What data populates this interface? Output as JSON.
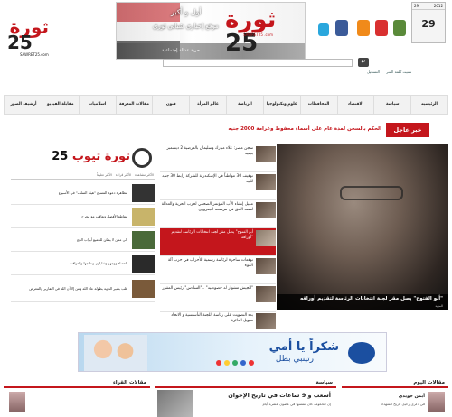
{
  "header": {
    "calendar": {
      "date_left": "29",
      "date_right": "2012",
      "day": "29"
    },
    "banner": {
      "logo_ar": "ثورة",
      "logo_num": "25",
      "site": "SAWRET25 .com",
      "slogan1": "أول و أكبر",
      "slogan2": "موقع إخباري شبابي ثوري",
      "slogan3": "حرية عدالة إجتماعية"
    },
    "logo": {
      "ar": "ثورة",
      "num": "25",
      "en": "SAWRET25.com"
    },
    "login": {
      "register": "التسجيل",
      "forgot": "نسيت كلمة السر"
    },
    "social_icons": [
      "calendar-icon",
      "youtube-icon",
      "rss-icon",
      "facebook-icon",
      "twitter-icon"
    ]
  },
  "nav": {
    "items": [
      "الرئيسيه",
      "سياسة",
      "الاقتصاد",
      "المحافظات",
      "علوم وتكنولوجيا",
      "الرياضة",
      "عالم المرأة",
      "فنون",
      "مقالات المعرفة",
      "اسلاميات",
      "مقابلة الفيديو",
      "أرشيف الصور"
    ]
  },
  "breaking": {
    "label": "خبر عاجل",
    "text": "الحكم بالسجن لمدة عام على أسماء محفوظ وغرامة 2000 جنيه"
  },
  "main_story": {
    "caption": "أبو الفتوح\" يصل مقر لجنة انتخابات الرئاسة لتقديم أوراقه\"",
    "sub": "المزيد"
  },
  "news": [
    {
      "text": "سجن مصر: علاء مبارك وسليمان بالعرضية 2 ديسمبر بجنيه"
    },
    {
      "text": "توقيف 30 مواطناً في الإسكندرية للشركة رابط 30 جنيه للبيه"
    },
    {
      "text": "مقيل إنشاء الأب المؤتمر الصحفي لحزب الحرية والعدالة لمنعه الحق في مرشحه الجنزوري"
    },
    {
      "text": "أبو الفتوح\" يصل مقر لجنة انتخابات الرئاسة لتقديم أوراقه\""
    },
    {
      "text": "توقعات ساحرة لرئاسة رسمية للأحزاب في حزب آلة القوة"
    },
    {
      "text": "الجيش مشوار له خصوصيه\" ..\"السادس\" رئيس المقرر\""
    },
    {
      "text": "بدء التصويت على رئاسة اللجنة التأسيسية و الاتحاد تحويل الدائرة"
    }
  ],
  "tube": {
    "title_ar": "ثورة",
    "title_num": "25",
    "title_end": "تيوب",
    "tabs": [
      "الأكثر مشاهدة",
      "الأكثر قراءة",
      "الأكثر تعليقاً"
    ],
    "items": [
      {
        "text": "مظاهرة دعوة المسيح \"هيئة السلف\" في الأسبوع"
      },
      {
        "text": "مقاطع الأفضل وتعاقب مع مخرج"
      },
      {
        "text": "إلى ممن لا يمكن للجميع أبواب الحج"
      },
      {
        "text": "القضاء ووجهو وشابلون ونتائجها والعواقب"
      },
      {
        "text": "قلب بشير الدوية بطولة عاد الله وتنن إلا أن الله في التقارير والمعرض"
      }
    ]
  },
  "ad": {
    "headline": "شكراً يا أمي",
    "subline": "رتينبي بطل"
  },
  "bottom": {
    "readers_title": "مقالات القراء",
    "politics_title": "سياسة",
    "politics_headline": "أسعب و 9 ساعات في تاريخ الإخوان",
    "politics_sub": "إن الحكومة كان لنفسها في غضون عشرة أيام",
    "articles_title": "مقالات اليوم",
    "article_author": "أيمن جويدي",
    "article_title": "في ذكرى رحيل تاريخ الشهداء"
  }
}
